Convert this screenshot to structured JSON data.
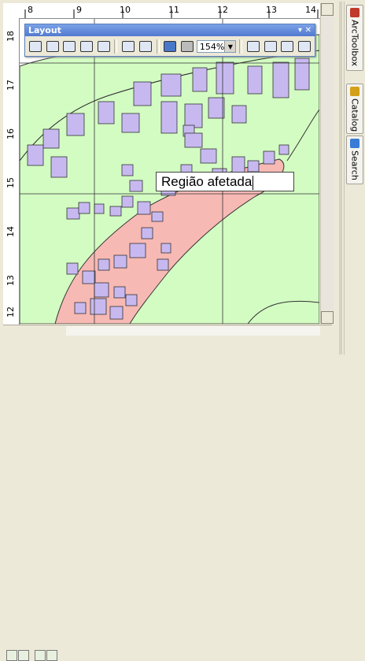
{
  "ruler": {
    "top_ticks": [
      "8",
      "9",
      "10",
      "11",
      "12",
      "13",
      "14"
    ],
    "left_ticks": [
      "18",
      "17",
      "16",
      "15",
      "14",
      "13",
      "12"
    ]
  },
  "toolbar": {
    "title": "Layout",
    "zoom_value": "154%"
  },
  "text_element": {
    "value": "Região afetada"
  },
  "sidebar": {
    "tabs": [
      {
        "label": "ArcToolbox",
        "icon": "arctoolbox-icon",
        "color": "#c0392b"
      },
      {
        "label": "Catalog",
        "icon": "catalog-icon",
        "color": "#d4a017"
      },
      {
        "label": "Search",
        "icon": "search-icon",
        "color": "#3a7bd5"
      }
    ]
  },
  "colors": {
    "map_green": "#d3fcc3",
    "affected_region": "#f7b9b4",
    "buildings": "#c7b9f0",
    "accent": "#5279d0"
  }
}
